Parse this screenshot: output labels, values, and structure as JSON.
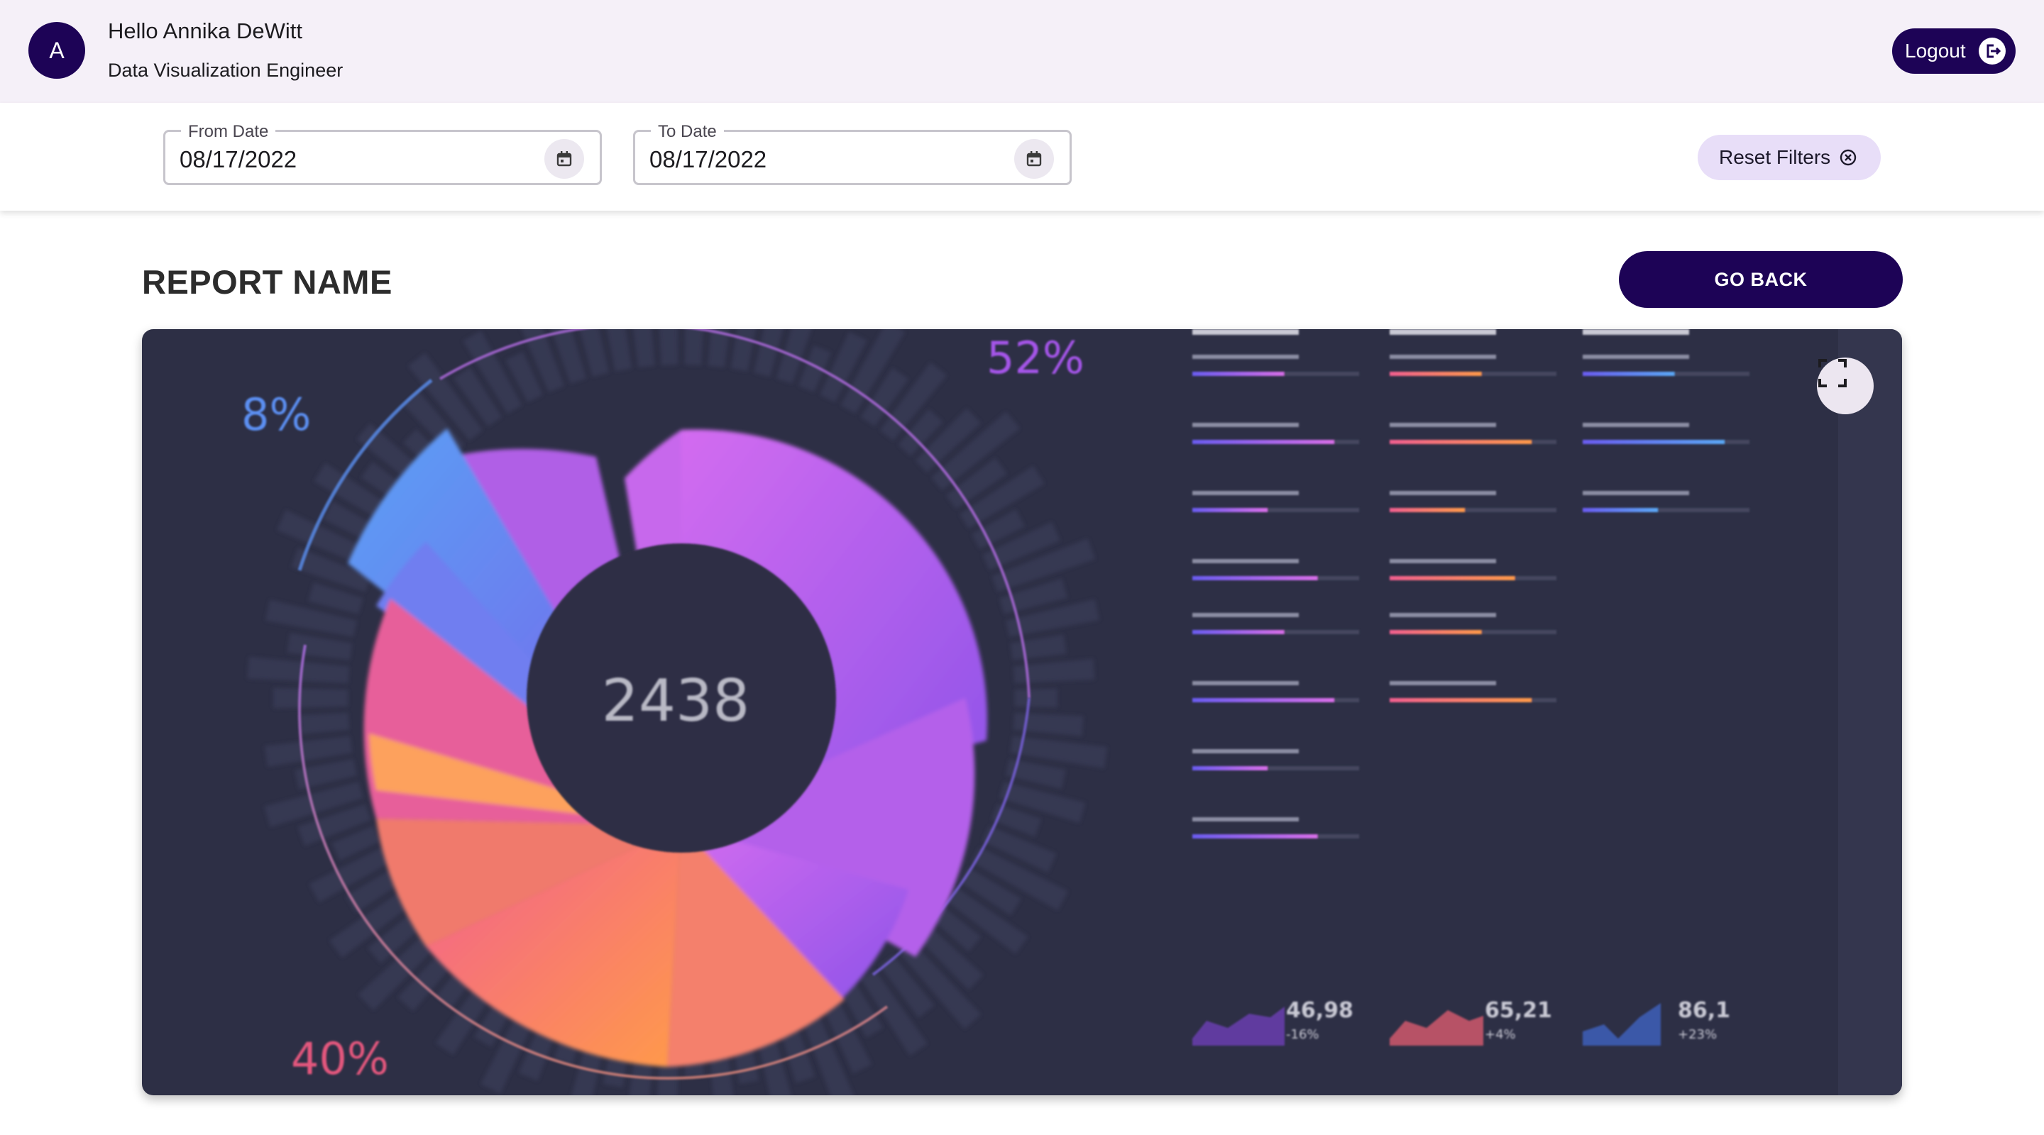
{
  "header": {
    "avatar_initial": "A",
    "greeting": "Hello Annika DeWitt",
    "role": "Data Visualization Engineer",
    "logout_label": "Logout"
  },
  "filters": {
    "from_label": "From Date",
    "from_value": "08/17/2022",
    "to_label": "To Date",
    "to_value": "08/17/2022",
    "reset_label": "Reset Filters"
  },
  "report": {
    "title": "REPORT NAME",
    "go_back_label": "GO BACK"
  },
  "visual": {
    "center_value": "2438",
    "pct_blue": "8%",
    "pct_purple": "52%",
    "pct_orange": "40%",
    "stats": [
      {
        "value": "46,98",
        "delta": "-16%"
      },
      {
        "value": "65,21",
        "delta": "+4%"
      },
      {
        "value": "86,1",
        "delta": "+23%"
      }
    ]
  },
  "colors": {
    "primary": "#1d0356",
    "header_bg": "#f5f0f8",
    "chip_bg": "#e8def8",
    "card_bg": "#2d2f45"
  }
}
